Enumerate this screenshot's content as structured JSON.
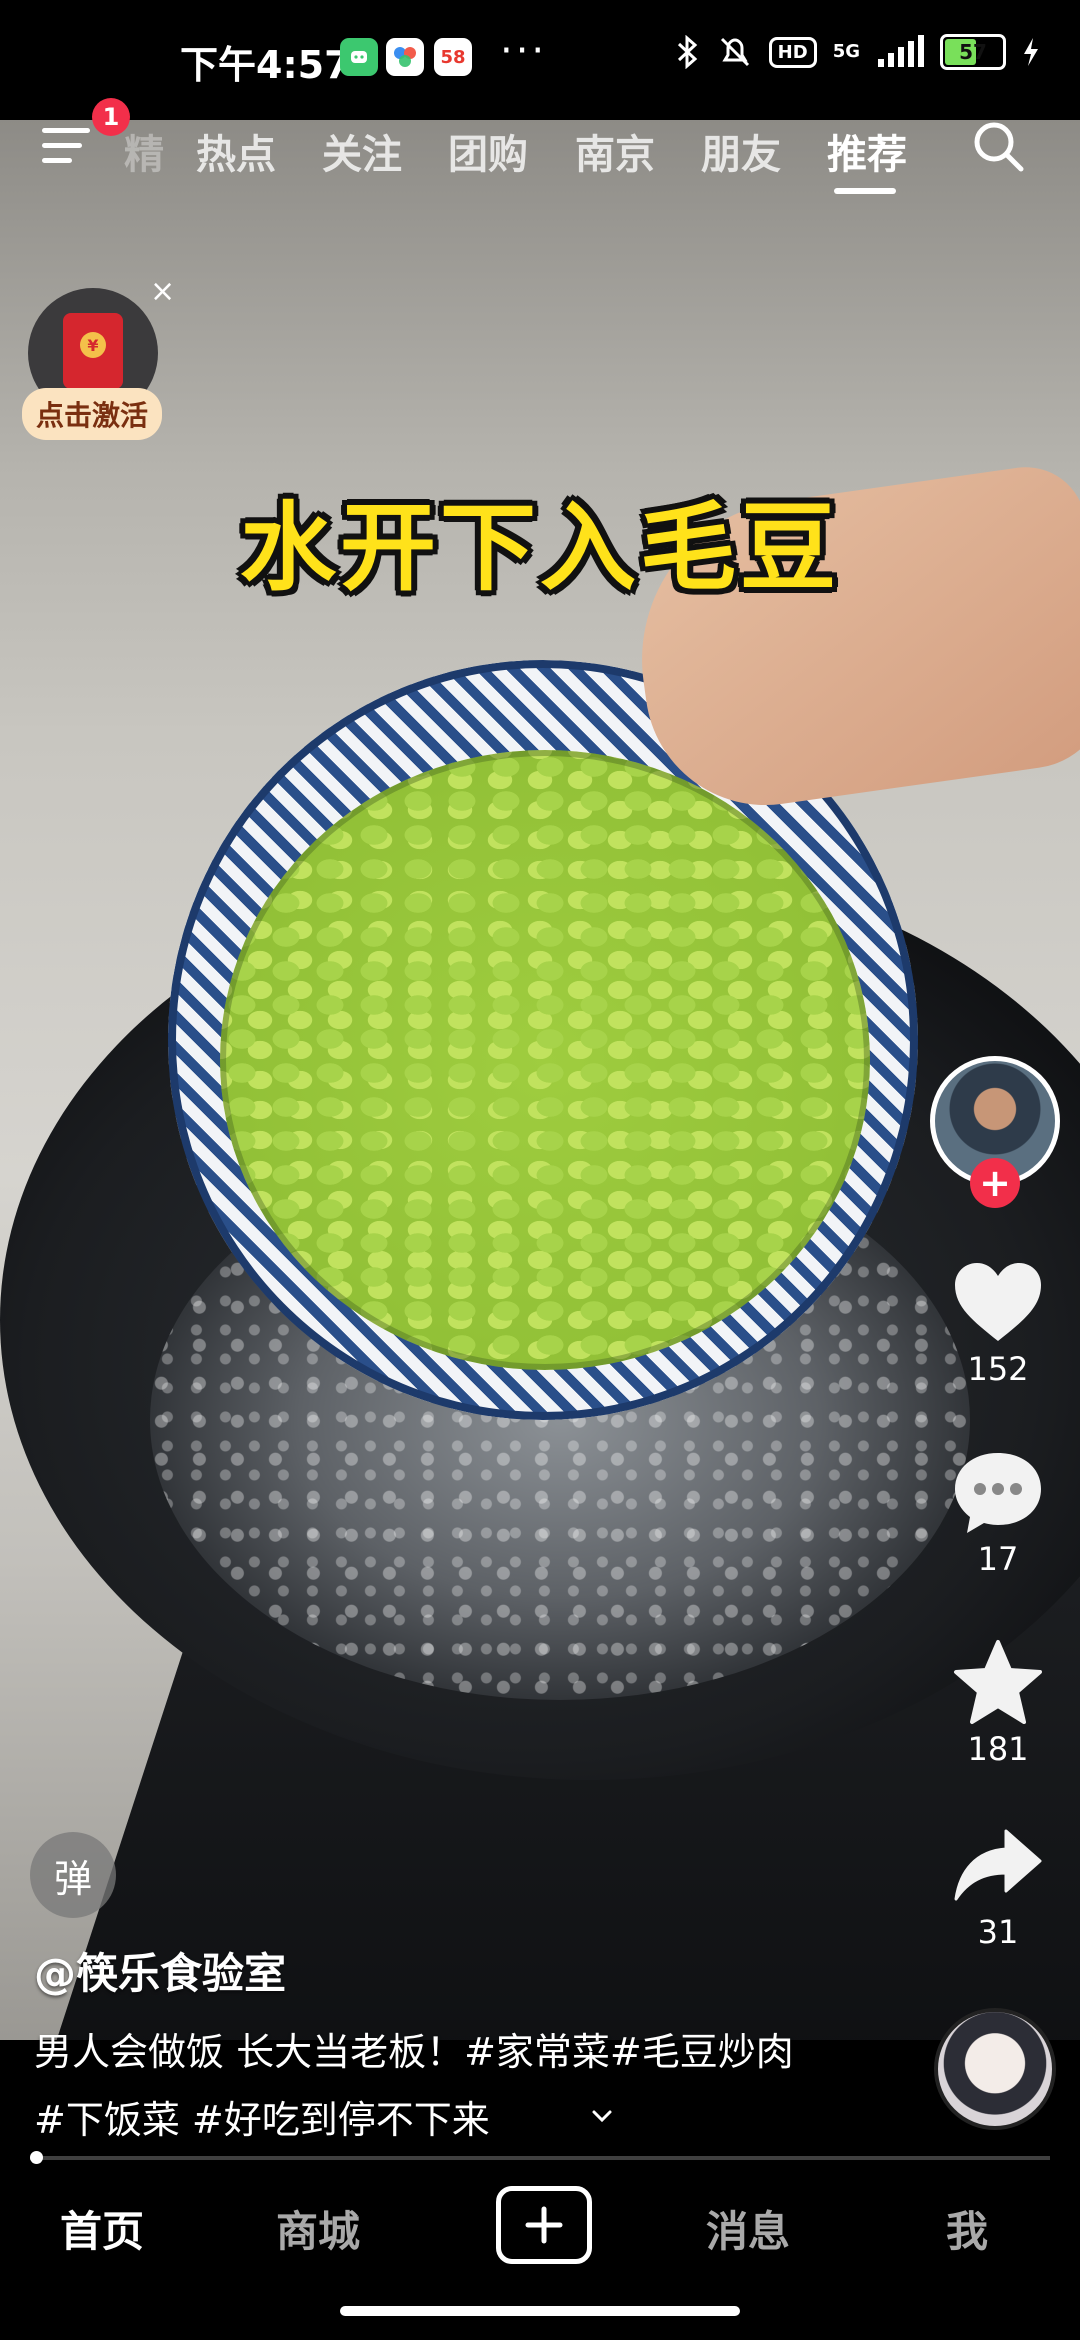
{
  "status_bar": {
    "time": "下午4:57",
    "apps": [
      {
        "icon": "app-green-icon",
        "label": "",
        "color": "#3cc86f"
      },
      {
        "icon": "app-multicolor-icon",
        "label": "",
        "color": "#ffffff"
      },
      {
        "icon": "app-58-icon",
        "label": "58",
        "color": "#ffffff"
      }
    ],
    "more": "···",
    "hd": "HD",
    "network": "5G",
    "battery": "57",
    "battery_level": 0.57
  },
  "top_nav": {
    "tabs": [
      {
        "label": "精",
        "state": "faded"
      },
      {
        "label": "热点",
        "state": "normal"
      },
      {
        "label": "关注",
        "state": "normal"
      },
      {
        "label": "团购",
        "state": "normal"
      },
      {
        "label": "南京",
        "state": "normal"
      },
      {
        "label": "朋友",
        "state": "normal"
      },
      {
        "label": "推荐",
        "state": "active"
      }
    ],
    "notification_count": "1"
  },
  "red_packet": {
    "label": "点击激活",
    "close": "×",
    "coin": "¥"
  },
  "video": {
    "caption": "水开下入毛豆"
  },
  "rail": {
    "follow": "+",
    "likes": "152",
    "comments": "17",
    "favorites": "181",
    "shares": "31"
  },
  "post": {
    "danmu": "弹",
    "author": "@筷乐食验室",
    "description": "男人会做饭 长大当老板！#家常菜#毛豆炒肉 #下饭菜 #好吃到停不下来",
    "progress": 0.004
  },
  "bottom_nav": {
    "home": "首页",
    "mall": "商城",
    "messages": "消息",
    "me": "我"
  }
}
